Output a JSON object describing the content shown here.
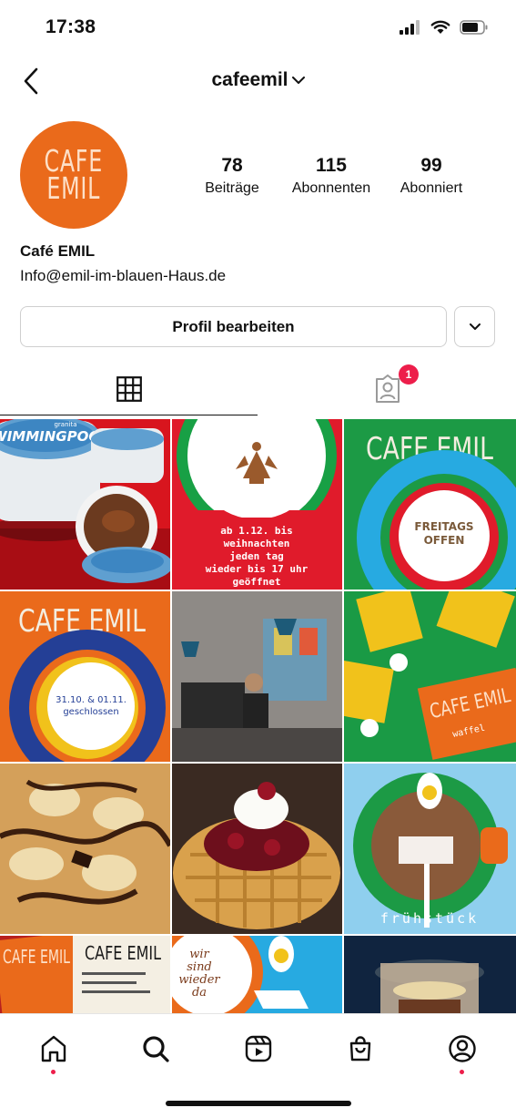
{
  "status": {
    "time": "17:38"
  },
  "header": {
    "username": "cafeemil"
  },
  "profile": {
    "avatar_text_1": "CAFE",
    "avatar_text_2": "EMIL",
    "posts_count": "78",
    "posts_label": "Beiträge",
    "followers_count": "115",
    "followers_label": "Abonnenten",
    "following_count": "99",
    "following_label": "Abonniert",
    "name": "Café EMIL",
    "bio": "Info@emil-im-blauen-Haus.de"
  },
  "actions": {
    "edit_label": "Profil bearbeiten"
  },
  "tabs": {
    "tagged_badge": "1"
  },
  "posts": [
    {
      "caption": "SWIMMINGPOOL",
      "subcaption": "granita"
    },
    {
      "caption_lines": [
        "ab 1.12. bis",
        "weihnachten",
        "jeden tag",
        "wieder bis 17 uhr",
        "geöffnet"
      ]
    },
    {
      "title": "CAFE EMIL",
      "caption_lines": [
        "FREITAGS",
        "OFFEN"
      ]
    },
    {
      "title": "CAFE EMIL",
      "caption_lines": [
        "31.10. & 01.11.",
        "geschlossen"
      ]
    },
    {
      "alt": "barista"
    },
    {
      "title": "CAFE EMIL",
      "caption": "waffel"
    },
    {
      "alt": "waffle-bananas"
    },
    {
      "alt": "waffle-cherries"
    },
    {
      "caption": "frühstück"
    },
    {
      "title": "CAFE EMIL"
    },
    {
      "caption_lines": [
        "wir",
        "sind",
        "wieder",
        "da"
      ]
    },
    {
      "alt": "dessert-glass"
    }
  ],
  "colors": {
    "accent": "#ed1e4b",
    "brand_orange": "#ea6a1b"
  }
}
